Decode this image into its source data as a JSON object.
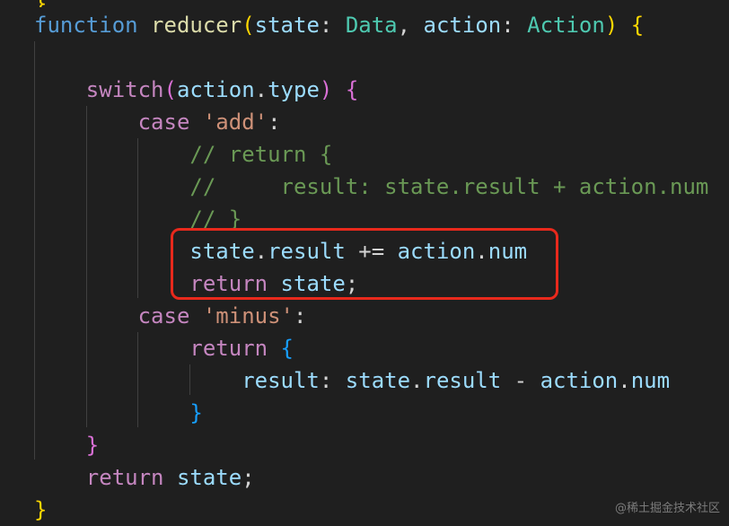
{
  "code": {
    "lines": [
      [
        {
          "t": "function",
          "c": "kw"
        },
        {
          "t": " ",
          "c": "punc"
        },
        {
          "t": "reducer",
          "c": "fn"
        },
        {
          "t": "(",
          "c": "b1"
        },
        {
          "t": "state",
          "c": "var"
        },
        {
          "t": ": ",
          "c": "punc"
        },
        {
          "t": "Data",
          "c": "type"
        },
        {
          "t": ", ",
          "c": "punc"
        },
        {
          "t": "action",
          "c": "var"
        },
        {
          "t": ": ",
          "c": "punc"
        },
        {
          "t": "Action",
          "c": "type"
        },
        {
          "t": ")",
          "c": "b1"
        },
        {
          "t": " ",
          "c": "punc"
        },
        {
          "t": "{",
          "c": "b1"
        }
      ],
      [],
      [
        {
          "t": "    ",
          "c": "punc"
        },
        {
          "t": "switch",
          "c": "ctrl"
        },
        {
          "t": "(",
          "c": "b2"
        },
        {
          "t": "action",
          "c": "var"
        },
        {
          "t": ".",
          "c": "punc"
        },
        {
          "t": "type",
          "c": "var"
        },
        {
          "t": ")",
          "c": "b2"
        },
        {
          "t": " ",
          "c": "punc"
        },
        {
          "t": "{",
          "c": "b2"
        }
      ],
      [
        {
          "t": "        ",
          "c": "punc"
        },
        {
          "t": "case",
          "c": "ctrl"
        },
        {
          "t": " ",
          "c": "punc"
        },
        {
          "t": "'add'",
          "c": "str"
        },
        {
          "t": ":",
          "c": "punc"
        }
      ],
      [
        {
          "t": "            ",
          "c": "punc"
        },
        {
          "t": "// return {",
          "c": "cmt"
        }
      ],
      [
        {
          "t": "            ",
          "c": "punc"
        },
        {
          "t": "//     result: state.result + action.num",
          "c": "cmt"
        }
      ],
      [
        {
          "t": "            ",
          "c": "punc"
        },
        {
          "t": "// }",
          "c": "cmt"
        }
      ],
      [
        {
          "t": "            ",
          "c": "punc"
        },
        {
          "t": "state",
          "c": "var"
        },
        {
          "t": ".",
          "c": "punc"
        },
        {
          "t": "result",
          "c": "var"
        },
        {
          "t": " += ",
          "c": "punc"
        },
        {
          "t": "action",
          "c": "var"
        },
        {
          "t": ".",
          "c": "punc"
        },
        {
          "t": "num",
          "c": "var"
        }
      ],
      [
        {
          "t": "            ",
          "c": "punc"
        },
        {
          "t": "return",
          "c": "ctrl"
        },
        {
          "t": " ",
          "c": "punc"
        },
        {
          "t": "state",
          "c": "var"
        },
        {
          "t": ";",
          "c": "punc"
        }
      ],
      [
        {
          "t": "        ",
          "c": "punc"
        },
        {
          "t": "case",
          "c": "ctrl"
        },
        {
          "t": " ",
          "c": "punc"
        },
        {
          "t": "'minus'",
          "c": "str"
        },
        {
          "t": ":",
          "c": "punc"
        }
      ],
      [
        {
          "t": "            ",
          "c": "punc"
        },
        {
          "t": "return",
          "c": "ctrl"
        },
        {
          "t": " ",
          "c": "punc"
        },
        {
          "t": "{",
          "c": "b3"
        }
      ],
      [
        {
          "t": "                ",
          "c": "punc"
        },
        {
          "t": "result",
          "c": "var"
        },
        {
          "t": ": ",
          "c": "punc"
        },
        {
          "t": "state",
          "c": "var"
        },
        {
          "t": ".",
          "c": "punc"
        },
        {
          "t": "result",
          "c": "var"
        },
        {
          "t": " - ",
          "c": "punc"
        },
        {
          "t": "action",
          "c": "var"
        },
        {
          "t": ".",
          "c": "punc"
        },
        {
          "t": "num",
          "c": "var"
        }
      ],
      [
        {
          "t": "            ",
          "c": "punc"
        },
        {
          "t": "}",
          "c": "b3"
        }
      ],
      [
        {
          "t": "    ",
          "c": "punc"
        },
        {
          "t": "}",
          "c": "b2"
        }
      ],
      [
        {
          "t": "    ",
          "c": "punc"
        },
        {
          "t": "return",
          "c": "ctrl"
        },
        {
          "t": " ",
          "c": "punc"
        },
        {
          "t": "state",
          "c": "var"
        },
        {
          "t": ";",
          "c": "punc"
        }
      ],
      [
        {
          "t": "}",
          "c": "b1"
        }
      ]
    ]
  },
  "colors": {
    "background": "#1f1f1f",
    "highlight_border": "#e8291c",
    "keyword": "#569cd6",
    "control": "#c586c0",
    "function": "#dcdcaa",
    "variable": "#9cdcfe",
    "type": "#4ec9b0",
    "string": "#ce9178",
    "comment": "#6a9955"
  },
  "watermark": {
    "text": "@稀土掘金技术社区"
  }
}
